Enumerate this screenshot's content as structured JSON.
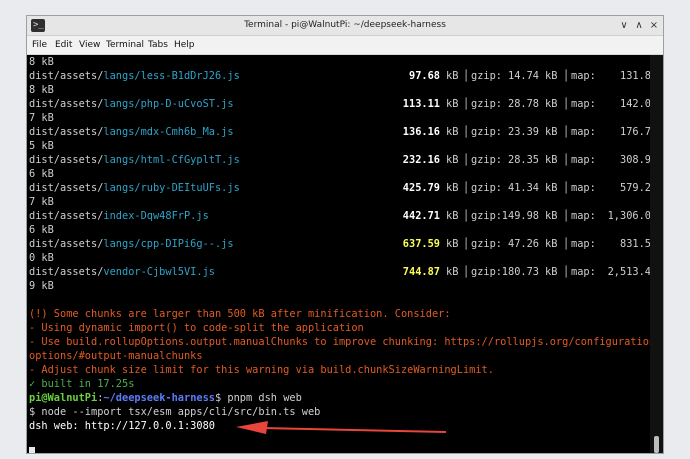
{
  "window": {
    "title": "Terminal - pi@WalnutPi: ~/deepseek-harness",
    "app_icon": ">_",
    "controls": {
      "minimize": "∨",
      "maximize": "∧",
      "close": "×"
    }
  },
  "menu": [
    "File",
    "Edit",
    "View",
    "Terminal",
    "Tabs",
    "Help"
  ],
  "build_rows": [
    {
      "prefix": "dist/assets/",
      "name": "langs/less-B1dDrJ26.js",
      "size": "97.68",
      "highlight": false,
      "gzip": "14.74",
      "map": "131.8",
      "map_size": "8 kB"
    },
    {
      "prefix": "dist/assets/",
      "name": "langs/php-D-uCvoST.js",
      "size": "113.11",
      "highlight": false,
      "gzip": "28.78",
      "map": "142.0",
      "map_size": "7 kB"
    },
    {
      "prefix": "dist/assets/",
      "name": "langs/mdx-Cmh6b_Ma.js",
      "size": "136.16",
      "highlight": false,
      "gzip": "23.39",
      "map": "176.7",
      "map_size": "5 kB"
    },
    {
      "prefix": "dist/assets/",
      "name": "langs/html-CfGypltT.js",
      "size": "232.16",
      "highlight": false,
      "gzip": "28.35",
      "map": "308.9",
      "map_size": "6 kB"
    },
    {
      "prefix": "dist/assets/",
      "name": "langs/ruby-DEItuUFs.js",
      "size": "425.79",
      "highlight": false,
      "gzip": "41.34",
      "map": "579.2",
      "map_size": "7 kB"
    },
    {
      "prefix": "dist/assets/",
      "name": "index-Dqw48FrP.js",
      "size": "442.71",
      "highlight": false,
      "gzip": "149.98",
      "map": "1,306.0",
      "map_size": "6 kB"
    },
    {
      "prefix": "dist/assets/",
      "name": "langs/cpp-DIPi6g--.js",
      "size": "637.59",
      "highlight": true,
      "gzip": "47.26",
      "map": "831.5",
      "map_size": "0 kB"
    },
    {
      "prefix": "dist/assets/",
      "name": "vendor-Cjbwl5VI.js",
      "size": "744.87",
      "highlight": true,
      "gzip": "180.73",
      "map": "2,513.4",
      "map_size": "9 kB"
    }
  ],
  "first_line": "8 kB",
  "units": {
    "kb": "kB",
    "gzip": "gzip:",
    "map": "map:",
    "sep": "│"
  },
  "warning_lines": [
    "(!) Some chunks are larger than 500 kB after minification. Consider:",
    "- Using dynamic import() to code-split the application",
    "- Use build.rollupOptions.output.manualChunks to improve chunking: https://rollupjs.org/configuration-",
    "options/#output-manualchunks",
    "- Adjust chunk size limit for this warning via build.chunkSizeWarningLimit."
  ],
  "built_line": "✓ built in 17.25s",
  "prompt": {
    "user": "pi@WalnutPi",
    "sep": ":",
    "path": "~/deepseek-harness",
    "dollar": "$",
    "command": "pnpm dsh web"
  },
  "exec_line": "$ node --import tsx/esm apps/cli/src/bin.ts web",
  "server_line": "dsh web: http://127.0.0.1:3080",
  "colors": {
    "terminal_bg": "#000000",
    "filename": "#2ea3c9",
    "size_highlight": "#ffff55",
    "warning": "#e25b22",
    "success": "#4caf50",
    "prompt_user": "#6bd13e",
    "prompt_path": "#5c7cfa",
    "arrow": "#e8453c"
  },
  "annotation": {
    "type": "arrow",
    "color": "#e8453c",
    "points_to": "server_line"
  }
}
